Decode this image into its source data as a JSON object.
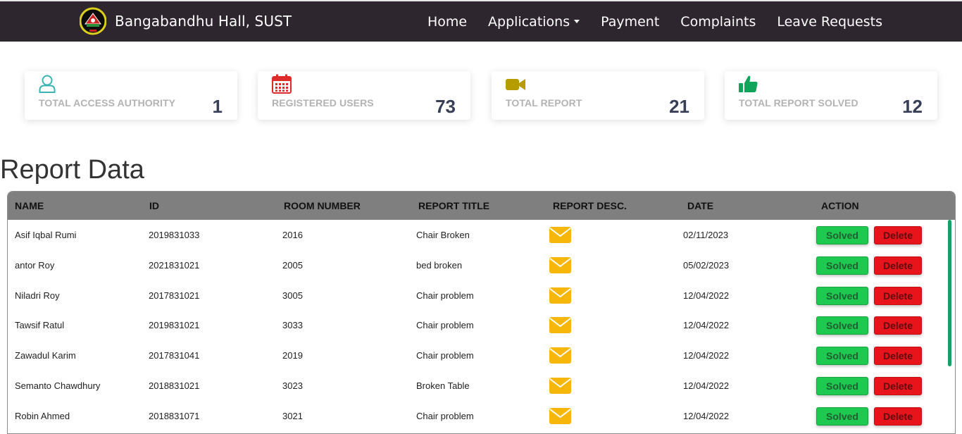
{
  "navbar": {
    "brand": "Bangabandhu Hall, SUST",
    "links": [
      {
        "label": "Home"
      },
      {
        "label": "Applications"
      },
      {
        "label": "Payment"
      },
      {
        "label": "Complaints"
      },
      {
        "label": "Leave Requests"
      }
    ]
  },
  "stats": [
    {
      "label": "TOTAL ACCESS AUTHORITY",
      "value": "1",
      "icon": "user-icon",
      "color": "#3cb4b4"
    },
    {
      "label": "REGISTERED USERS",
      "value": "73",
      "icon": "calendar-icon",
      "color": "#e02b2b"
    },
    {
      "label": "TOTAL REPORT",
      "value": "21",
      "icon": "video-camera-icon",
      "color": "#b79c00"
    },
    {
      "label": "TOTAL REPORT SOLVED",
      "value": "12",
      "icon": "thumbs-up-icon",
      "color": "#10a35a"
    }
  ],
  "report": {
    "title": "Report Data",
    "columns": [
      "NAME",
      "ID",
      "ROOM NUMBER",
      "REPORT TITLE",
      "REPORT DESC.",
      "DATE",
      "ACTION"
    ],
    "rows": [
      {
        "name": "Asif Iqbal Rumi",
        "id": "2019831033",
        "room": "2016",
        "title": "Chair Broken",
        "date": "02/11/2023"
      },
      {
        "name": "antor Roy",
        "id": "2021831021",
        "room": "2005",
        "title": "bed broken",
        "date": "05/02/2023"
      },
      {
        "name": "Niladri Roy",
        "id": "2017831021",
        "room": "3005",
        "title": "Chair problem",
        "date": "12/04/2022"
      },
      {
        "name": "Tawsif Ratul",
        "id": "2019831021",
        "room": "3033",
        "title": "Chair problem",
        "date": "12/04/2022"
      },
      {
        "name": "Zawadul Karim",
        "id": "2017831041",
        "room": "2019",
        "title": "Chair problem",
        "date": "12/04/2022"
      },
      {
        "name": "Semanto Chawdhury",
        "id": "2018831021",
        "room": "3023",
        "title": "Broken Table",
        "date": "12/04/2022"
      },
      {
        "name": "Robin Ahmed",
        "id": "2018831071",
        "room": "3021",
        "title": "Chair problem",
        "date": "12/04/2022"
      }
    ],
    "solved_label": "Solved",
    "delete_label": "Delete",
    "desc_icon": "envelope-icon",
    "colors": {
      "header": "#7f7f7f",
      "solved": "#1ec94f",
      "delete": "#e8141c",
      "envelope": "#f6b70a"
    }
  }
}
